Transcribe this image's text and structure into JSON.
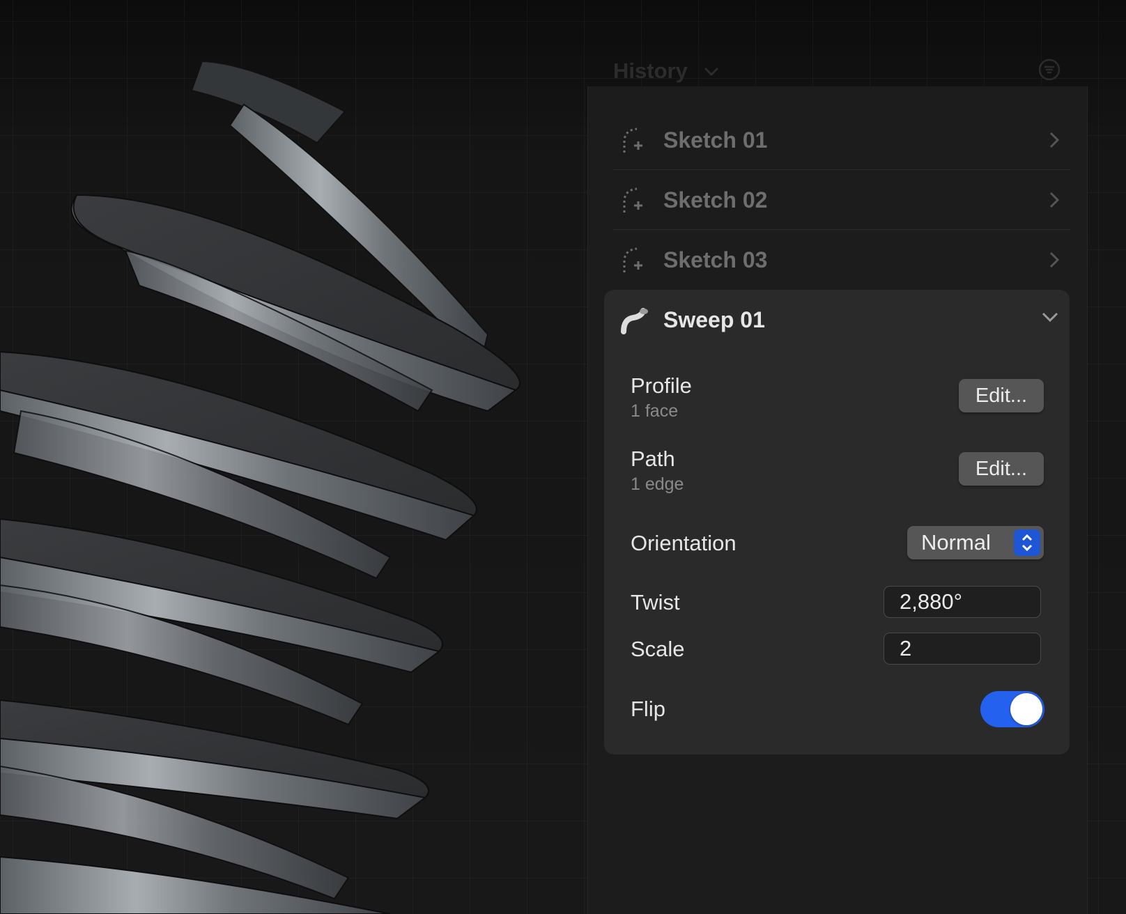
{
  "history": {
    "title": "History",
    "items": [
      {
        "label": "Sketch 01"
      },
      {
        "label": "Sketch 02"
      },
      {
        "label": "Sketch 03"
      }
    ]
  },
  "sweep": {
    "title": "Sweep 01",
    "profile": {
      "label": "Profile",
      "sub": "1 face",
      "button": "Edit..."
    },
    "path": {
      "label": "Path",
      "sub": "1 edge",
      "button": "Edit..."
    },
    "orientation": {
      "label": "Orientation",
      "value": "Normal"
    },
    "twist": {
      "label": "Twist",
      "value": "2,880°"
    },
    "scale": {
      "label": "Scale",
      "value": "2"
    },
    "flip": {
      "label": "Flip",
      "on": true
    }
  },
  "colors": {
    "accent": "#2461ee",
    "panel": "#1c1c1c",
    "card": "#2a2a2a"
  }
}
